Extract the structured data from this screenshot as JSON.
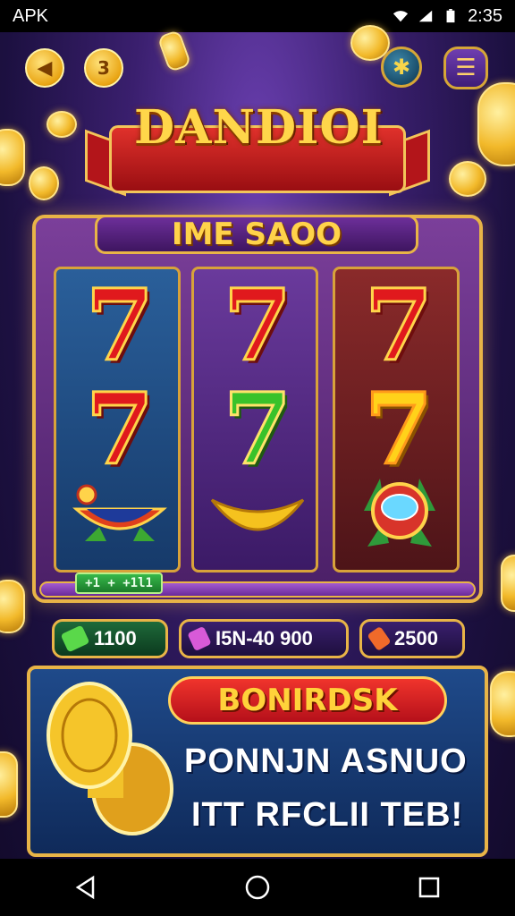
{
  "statusbar": {
    "app_label": "APK",
    "time": "2:35"
  },
  "top_buttons": {
    "coin_count": "3"
  },
  "title": "DANDIOI",
  "machine": {
    "header": "IME SAOO",
    "win_tag": "+1 + +1l1"
  },
  "stats": [
    {
      "value": "1100"
    },
    {
      "value": "I5N-40 900"
    },
    {
      "value": "2500"
    }
  ],
  "bonus": {
    "ribbon": "BONIRDSK",
    "line1": "PONNJN ASNUO",
    "line2": "ITT RFCLII TEB!"
  },
  "colors": {
    "gold": "#e8b447",
    "red": "#e0191d",
    "purple": "#3a1f6e"
  }
}
